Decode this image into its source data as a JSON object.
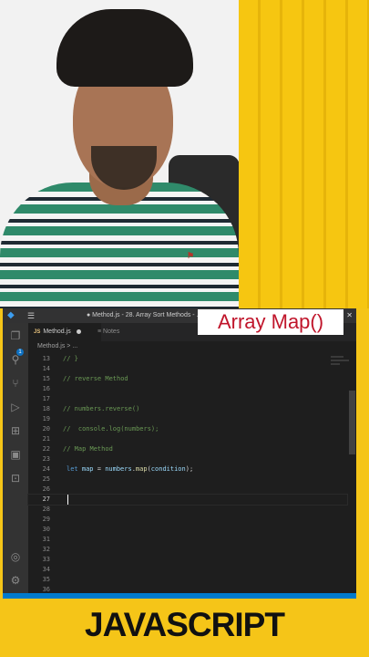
{
  "window": {
    "title": "● Method.js - 28. Array Sort Methods - ..."
  },
  "tabs": [
    {
      "label": "Method.js",
      "icon": "JS"
    },
    {
      "label": "Notes"
    }
  ],
  "breadcrumb": "Method.js > ...",
  "overlay_title": "Array Map()",
  "footer_title": "JAVASCRIPT",
  "editor": {
    "lines": [
      {
        "n": "13",
        "text": "// }"
      },
      {
        "n": "14",
        "text": ""
      },
      {
        "n": "15",
        "text": "// reverse Method"
      },
      {
        "n": "16",
        "text": ""
      },
      {
        "n": "17",
        "text": ""
      },
      {
        "n": "18",
        "text": "// numbers.reverse()"
      },
      {
        "n": "19",
        "text": ""
      },
      {
        "n": "20",
        "text": "//  console.log(numbers);"
      },
      {
        "n": "21",
        "text": ""
      },
      {
        "n": "22",
        "text": "// Map Method"
      },
      {
        "n": "23",
        "text": ""
      },
      {
        "n": "24",
        "text": "let map = numbers.map(condition);"
      },
      {
        "n": "25",
        "text": ""
      },
      {
        "n": "26",
        "text": ""
      },
      {
        "n": "27",
        "text": ""
      },
      {
        "n": "28",
        "text": ""
      },
      {
        "n": "29",
        "text": ""
      },
      {
        "n": "30",
        "text": ""
      },
      {
        "n": "31",
        "text": ""
      },
      {
        "n": "32",
        "text": ""
      },
      {
        "n": "33",
        "text": ""
      },
      {
        "n": "34",
        "text": ""
      },
      {
        "n": "35",
        "text": ""
      },
      {
        "n": "36",
        "text": ""
      }
    ],
    "current_line": "27"
  },
  "colors": {
    "accent": "#007acc",
    "overlay_text": "#c0152b",
    "background_yellow": "#f5c518"
  },
  "icons": [
    "vscode-icon",
    "menu-icon",
    "explorer-icon",
    "search-icon",
    "source-control-icon",
    "run-debug-icon",
    "extensions-icon",
    "remote-icon",
    "terminal-icon",
    "account-icon",
    "settings-gear-icon"
  ]
}
